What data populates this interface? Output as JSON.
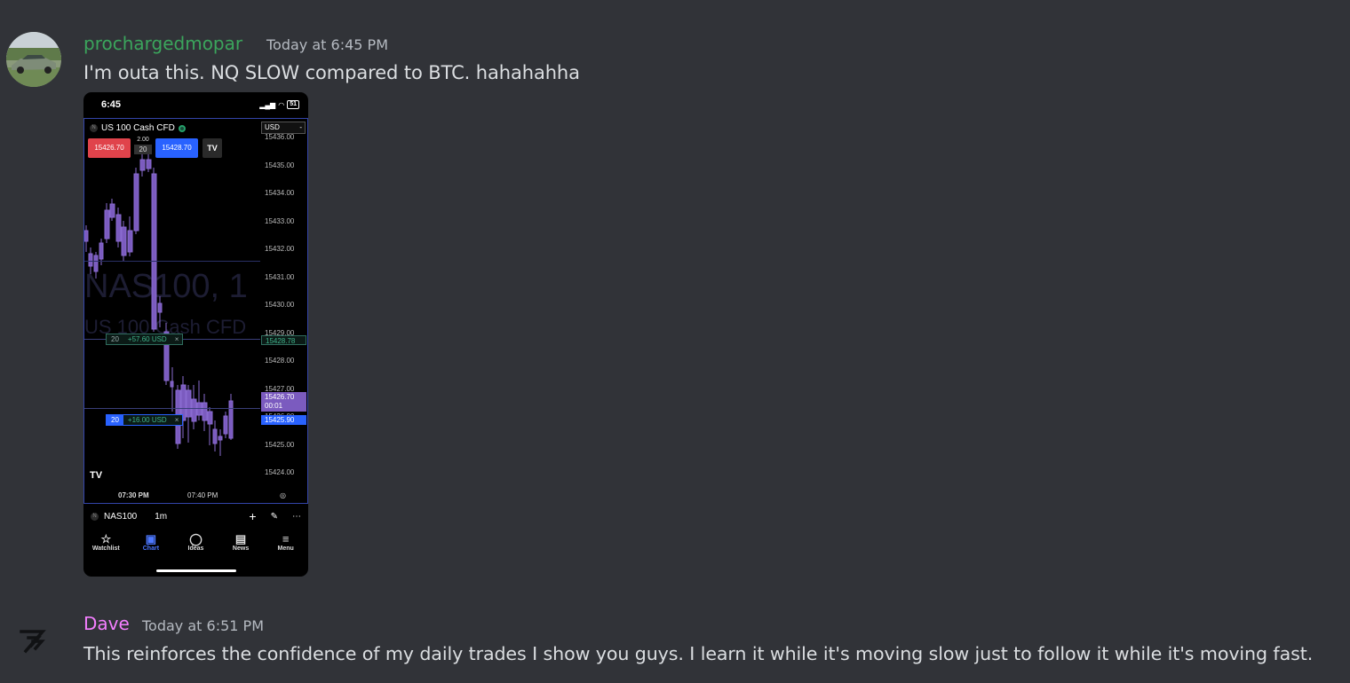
{
  "messages": [
    {
      "username": "prochargedmopar",
      "username_color": "#3ba55c",
      "timestamp": "Today at 6:45 PM",
      "text": "I'm outa this. NQ SLOW compared to BTC.  hahahahha"
    },
    {
      "username": "Dave",
      "username_color": "#f47fff",
      "timestamp": "Today at 6:51 PM",
      "text": "This reinforces the confidence of my daily trades I show you guys. I learn it while it's moving slow just to follow it while it's moving fast."
    }
  ],
  "phone": {
    "status_time": "6:45",
    "battery": "51",
    "symbol_title": "US 100 Cash CFD",
    "currency": "USD",
    "sell_price": "15426.70",
    "spread": "2.00",
    "quantity": "20",
    "buy_price": "15428.70",
    "watermark_symbol": "NAS100, 1",
    "watermark_name": "US 100 Cash CFD",
    "price_axis": [
      "15436.00",
      "15435.00",
      "15434.00",
      "15433.00",
      "15432.00",
      "15431.00",
      "15430.00",
      "15429.00",
      "15428.00",
      "15427.00",
      "15426.00",
      "15425.00",
      "15424.00"
    ],
    "position1": {
      "qty": "20",
      "pnl": "+57.60 USD",
      "close": "×",
      "price": "15428.78"
    },
    "position2": {
      "qty": "20",
      "pnl": "+16.00 USD",
      "close": "×",
      "price": "15425.90"
    },
    "current_price": "15426.70",
    "countdown": "00:01",
    "time_labels": [
      "07:30 PM",
      "07:40 PM"
    ],
    "bottom_symbol": "NAS100",
    "interval": "1m",
    "nav": [
      "Watchlist",
      "Chart",
      "Ideas",
      "News",
      "Menu"
    ],
    "nav_active": "Chart"
  }
}
